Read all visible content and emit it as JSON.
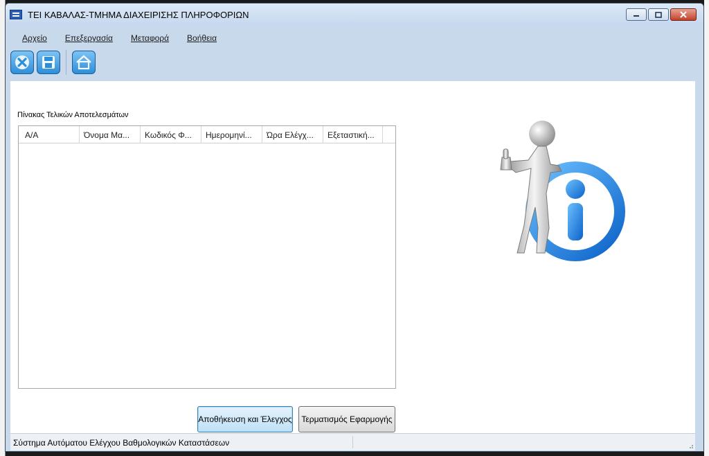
{
  "window": {
    "title": "ΤΕΙ ΚΑΒΑΛΑΣ-ΤΜΗΜΑ ΔΙΑΧΕΙΡΙΣΗΣ ΠΛΗΡΟΦΟΡΙΩΝ",
    "controls": [
      "minimize",
      "maximize",
      "close"
    ]
  },
  "menu": {
    "items": [
      "Αρχείο",
      "Επεξεργασία",
      "Μεταφορά",
      "Βοήθεια"
    ]
  },
  "toolbar": {
    "buttons": [
      "close-icon",
      "save-icon",
      "home-icon"
    ]
  },
  "table": {
    "caption": "Πίνακας Τελικών Αποτελεσμάτων",
    "columns": [
      "Α/Α",
      "Όνομα Μα...",
      "Κωδικός Φ...",
      "Ημερομηνί...",
      "Ώρα Ελέγχ...",
      "Εξεταστική..."
    ],
    "rows": []
  },
  "buttons": {
    "save_check": "Αποθήκευση και Έλεγχος",
    "exit": "Τερματισμός Εφαρμογής"
  },
  "status": {
    "text": "Σύστημα Αυτόματου Ελέγχου Βαθμολογικών Καταστάσεων"
  },
  "illustration": "info-figure-icon",
  "colors": {
    "accent": "#1a7fe0",
    "titlebar": "#c6d8ee"
  }
}
